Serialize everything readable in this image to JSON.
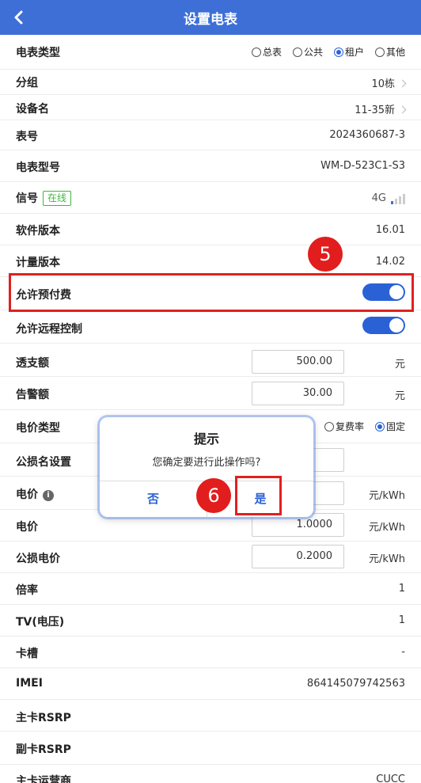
{
  "header": {
    "title": "设置电表"
  },
  "meter_type": {
    "label": "电表类型",
    "options": [
      "总表",
      "公共",
      "租户",
      "其他"
    ],
    "selected": "租户"
  },
  "group": {
    "label": "分组",
    "value": "10栋"
  },
  "device_name": {
    "label": "设备名",
    "value": "11-35新"
  },
  "meter_no": {
    "label": "表号",
    "value": "2024360687-3"
  },
  "model": {
    "label": "电表型号",
    "value": "WM-D-523C1-S3"
  },
  "signal": {
    "label": "信号",
    "status": "在线",
    "network": "4G",
    "strength": 1
  },
  "software_version": {
    "label": "软件版本",
    "value": "16.01"
  },
  "metering_version": {
    "label": "计量版本",
    "value": "14.02"
  },
  "allow_prepay": {
    "label": "允许预付费",
    "on": true
  },
  "allow_remote": {
    "label": "允许远程控制",
    "on": true
  },
  "overdraft": {
    "label": "透支额",
    "value": "500.00",
    "unit": "元"
  },
  "alarm": {
    "label": "告警额",
    "value": "30.00",
    "unit": "元"
  },
  "price_type": {
    "label": "电价类型",
    "options": [
      "复费率",
      "固定"
    ],
    "selected": "固定"
  },
  "loss_name": {
    "label": "公损名设置"
  },
  "price_1": {
    "label": "电价",
    "unit": "元/kWh"
  },
  "price_2": {
    "label": "电价",
    "value": "1.0000",
    "unit": "元/kWh"
  },
  "loss_price": {
    "label": "公损电价",
    "value": "0.2000",
    "unit": "元/kWh"
  },
  "ratio": {
    "label": "倍率",
    "value": "1"
  },
  "tv": {
    "label": "TV(电压)",
    "value": "1"
  },
  "card_slot": {
    "label": "卡槽",
    "value": "-"
  },
  "imei": {
    "label": "IMEI",
    "value": "864145079742563"
  },
  "main_rsrp": {
    "label": "主卡RSRP"
  },
  "sub_rsrp": {
    "label": "副卡RSRP"
  },
  "main_operator": {
    "label": "主卡运营商",
    "value": "CUCC"
  },
  "dialog": {
    "title": "提示",
    "message": "您确定要进行此操作吗?",
    "cancel": "否",
    "confirm": "是"
  },
  "annotations": {
    "step5": "5",
    "step6": "6"
  },
  "colors": {
    "header": "#3d6fd7",
    "accent": "#2a62d6",
    "highlight": "#e02020",
    "online": "#3cb83c"
  }
}
